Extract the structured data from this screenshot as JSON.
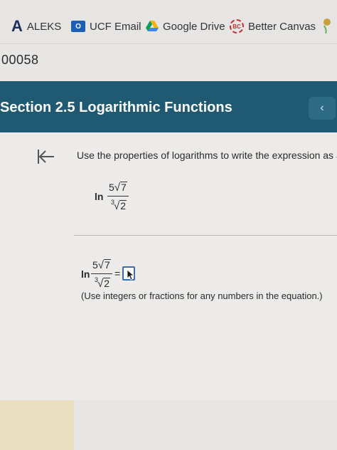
{
  "bookmarks": {
    "aleks": {
      "icon": "aleks-logo-icon",
      "logo": "A",
      "label": "ALEKS"
    },
    "ucf": {
      "icon": "outlook-icon",
      "glyph": "O",
      "label": "UCF Email"
    },
    "drive": {
      "icon": "google-drive-icon",
      "label": "Google Drive"
    },
    "canvas": {
      "icon": "better-canvas-icon",
      "glyph": "BC",
      "label": "Better Canvas"
    }
  },
  "account_id": "00058",
  "section": {
    "title": "Section 2.5 Logarithmic Functions",
    "collapse_glyph": "‹"
  },
  "problem": {
    "instruction": "Use the properties of logarithms to write the expression as a s",
    "expression": {
      "fn": "ln",
      "numerator_coeff": "5",
      "numerator_radicand": "7",
      "denominator_index": "3",
      "denominator_radicand": "2"
    },
    "equals": "=",
    "note": "(Use integers or fractions for any numbers in the equation.)"
  },
  "colors": {
    "header": "#1f5a72",
    "accent_border": "#3a6ea5",
    "canvas_red": "#c6302f",
    "drive_yellow": "#f4b400",
    "drive_green": "#0f9d58",
    "drive_blue": "#4285f4"
  }
}
